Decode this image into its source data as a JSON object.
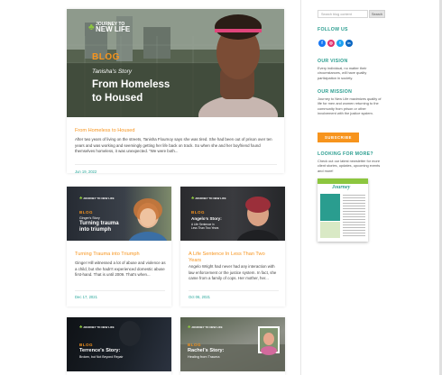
{
  "hero": {
    "logo_text": "JOURNEY TO",
    "logo_text2": "NEW LIFE",
    "blog_label": "BLOG",
    "story_name": "Tanisha's Story",
    "headline_line1": "From Homeless",
    "headline_line2": "to Housed",
    "title": "From Homeless to Housed",
    "excerpt": "After two years of living on the streets, Tanisha Flournoy says she was tired. She had been out of prison over ten years and was working and seemingly getting her life back on track. So when she and her boyfriend found themselves homeless, it was unexpected. \"We were both...",
    "date": "Jun 19, 2022"
  },
  "posts": [
    {
      "logo_text": "JOURNEY TO NEW LIFE",
      "blog_label": "BLOG",
      "story_name": "Ginger's Story",
      "headline_line1": "Turning trauma",
      "headline_line2": "into triumph",
      "title": "Turning Trauma into Triumph",
      "excerpt": "Ginger Hill witnessed a lot of abuse and violence as a child, but she hadn't experienced domestic abuse first-hand. That is until 2009. That's when...",
      "date": "Dec 17, 2021"
    },
    {
      "logo_text": "JOURNEY TO NEW LIFE",
      "blog_label": "BLOG",
      "story_name": "Angelo's Story:",
      "headline_line1": "A Life Sentence in",
      "headline_line2": "Less Than Two Years",
      "title": "A Life Sentence In Less Than Two Years",
      "excerpt": "Angelo Wright had never had any interaction with law enforcement or the justice system. In fact, she came from a family of cops. Her mother, her...",
      "date": "Oct 06, 2021"
    },
    {
      "logo_text": "JOURNEY TO NEW LIFE",
      "blog_label": "BLOG",
      "story_name": "Terrence's Story:",
      "headline_line1": "Broken, but Not Beyond Repair"
    },
    {
      "logo_text": "JOURNEY TO NEW LIFE",
      "blog_label": "BLOG",
      "story_name": "Rachel's Story:",
      "headline_line1": "Healing from Trauma"
    }
  ],
  "sidebar": {
    "search_placeholder": "Search blog content",
    "search_button": "Search",
    "follow_heading": "FOLLOW US",
    "social": [
      {
        "icon": "facebook-icon",
        "glyph": "f",
        "color": "#1877f2"
      },
      {
        "icon": "instagram-icon",
        "glyph": "◎",
        "color": "#e1306c"
      },
      {
        "icon": "twitter-icon",
        "glyph": "t",
        "color": "#1da1f2"
      },
      {
        "icon": "linkedin-icon",
        "glyph": "in",
        "color": "#0a66c2"
      }
    ],
    "vision_heading": "OUR VISION",
    "vision_text": "Every individual, no matter their circumstances, will have quality participation in society.",
    "mission_heading": "OUR MISSION",
    "mission_text": "Journey to New Life maximizes quality of life for men and women returning to the community from prison or other involvement with the justice system.",
    "subscribe_label": "SUBSCRIBE",
    "more_heading": "LOOKING FOR MORE?",
    "more_text": "Check out our latest newsletter for more client stories, updates, upcoming events and more!",
    "newsletter_title": "Journey"
  },
  "colors": {
    "accent_orange": "#f7941d",
    "accent_teal": "#2a9d8f",
    "logo_green": "#8cc63f"
  }
}
